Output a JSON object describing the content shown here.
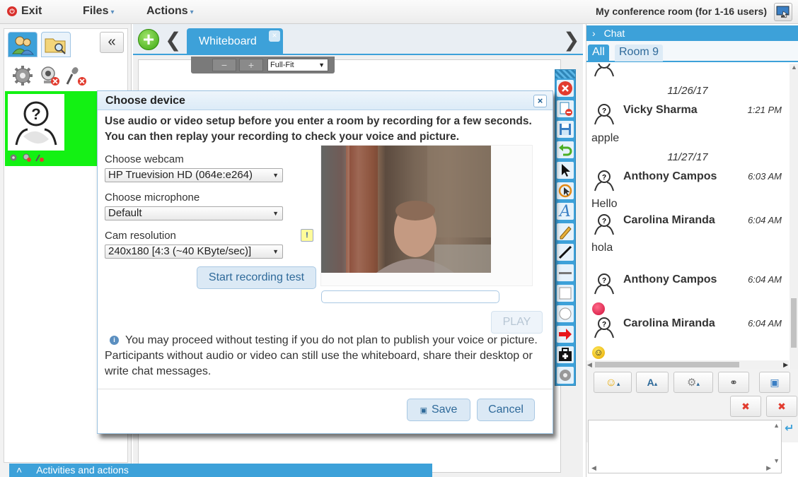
{
  "topbar": {
    "exit_label": "Exit",
    "files_label": "Files",
    "actions_label": "Actions",
    "room_title": "My conference room (for 1-16 users)"
  },
  "left": {
    "icons": [
      "users-icon",
      "files-icon",
      "settings-icon",
      "webcam-off-icon",
      "mic-off-icon"
    ],
    "collapse_symbol": "«",
    "user_card_color": "#13f113"
  },
  "whiteboard": {
    "add_symbol": "+",
    "prev_symbol": "❮",
    "next_symbol": "❯",
    "tab_label": "Whiteboard",
    "tab_close": "×",
    "zoom_out": "−",
    "zoom_in": "+",
    "zoom_mode": "Full-Fit",
    "accent": "#3da1d9"
  },
  "dialog": {
    "title": "Choose device",
    "close": "×",
    "intro": "Use audio or video setup before you enter a room by recording for a few seconds. You can then replay your recording to check your voice and picture.",
    "webcam_label": "Choose webcam",
    "webcam_value": "HP Truevision HD (064e:e264)",
    "mic_label": "Choose microphone",
    "mic_value": "Default",
    "res_label": "Cam resolution",
    "res_value": "240x180 [4:3 (~40 KByte/sec)]",
    "warn_symbol": "!",
    "record_btn": "Start recording test",
    "play_btn": "PLAY",
    "info_text": "You may proceed without testing if you do not plan to publish your voice or picture. Participants without audio or video can still use the whiteboard, share their desktop or write chat messages.",
    "save_btn": "Save",
    "cancel_btn": "Cancel"
  },
  "activities": {
    "label": "Activities and actions",
    "caret": "˄"
  },
  "chat": {
    "header": "Chat",
    "header_caret": "›",
    "tabs": [
      "All",
      "Room 9"
    ],
    "cut_name": "",
    "dates": [
      "11/26/17",
      "11/27/17"
    ],
    "messages": [
      {
        "name": "Vicky Sharma",
        "time": "1:21 PM",
        "text": "apple"
      },
      {
        "name": "Anthony Campos",
        "time": "6:03 AM",
        "text": "Hello"
      },
      {
        "name": "Carolina Miranda",
        "time": "6:04 AM",
        "text": "hola"
      },
      {
        "name": "Anthony Campos",
        "time": "6:04 AM",
        "text": ""
      },
      {
        "name": "Carolina Miranda",
        "time": "6:04 AM",
        "text": ""
      }
    ],
    "emoji_symbols": [
      "☺",
      "☺"
    ],
    "toolbar": {
      "font_label": "A",
      "caret": "▴",
      "send_symbol": "↵"
    }
  }
}
